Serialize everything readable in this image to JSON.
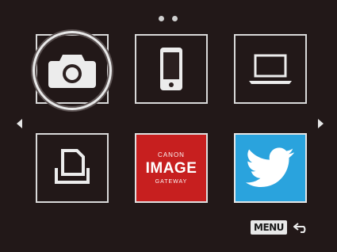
{
  "page_indicator": {
    "count": 2
  },
  "tiles": [
    {
      "id": "camera",
      "icon": "camera-icon",
      "selected": true
    },
    {
      "id": "smartphone",
      "icon": "smartphone-icon"
    },
    {
      "id": "computer",
      "icon": "laptop-icon"
    },
    {
      "id": "printer",
      "icon": "printer-icon"
    },
    {
      "id": "canon-image-gateway",
      "icon": "canon-image-gateway-logo",
      "logo_top": "CANON",
      "logo_mid": "IMAGE",
      "logo_bot": "GATEWAY",
      "color": "#c71f1f"
    },
    {
      "id": "twitter",
      "icon": "twitter-bird-icon",
      "color": "#2aa3dd"
    }
  ],
  "nav": {
    "left_icon": "left-arrow-icon",
    "right_icon": "right-arrow-icon"
  },
  "footer": {
    "menu_label": "MENU",
    "back_icon": "back-arrow-icon"
  }
}
